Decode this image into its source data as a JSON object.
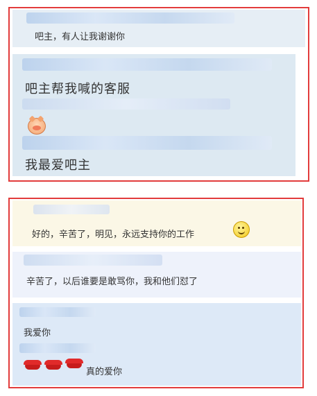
{
  "top_panel": {
    "comment1": "吧主，有人让我谢谢你",
    "comment2_line1": "吧主帮我喊的客服",
    "comment3": "我最爱吧主"
  },
  "bottom_panel": {
    "reply1": "好的，辛苦了，明见，永远支持你的工作",
    "reply2": "辛苦了，以后谁要是敢骂你，我和他们怼了",
    "reply3": "我爱你",
    "reply4": "真的爱你"
  },
  "colors": {
    "border": "#e23b3b",
    "card_light_blue": "#dde9f7",
    "card_cream": "#fbf7e6",
    "card_pale": "#eef2fb"
  },
  "icons": [
    "pig-emoji-icon",
    "smile-emoji-icon",
    "lips-emoji-icon"
  ]
}
